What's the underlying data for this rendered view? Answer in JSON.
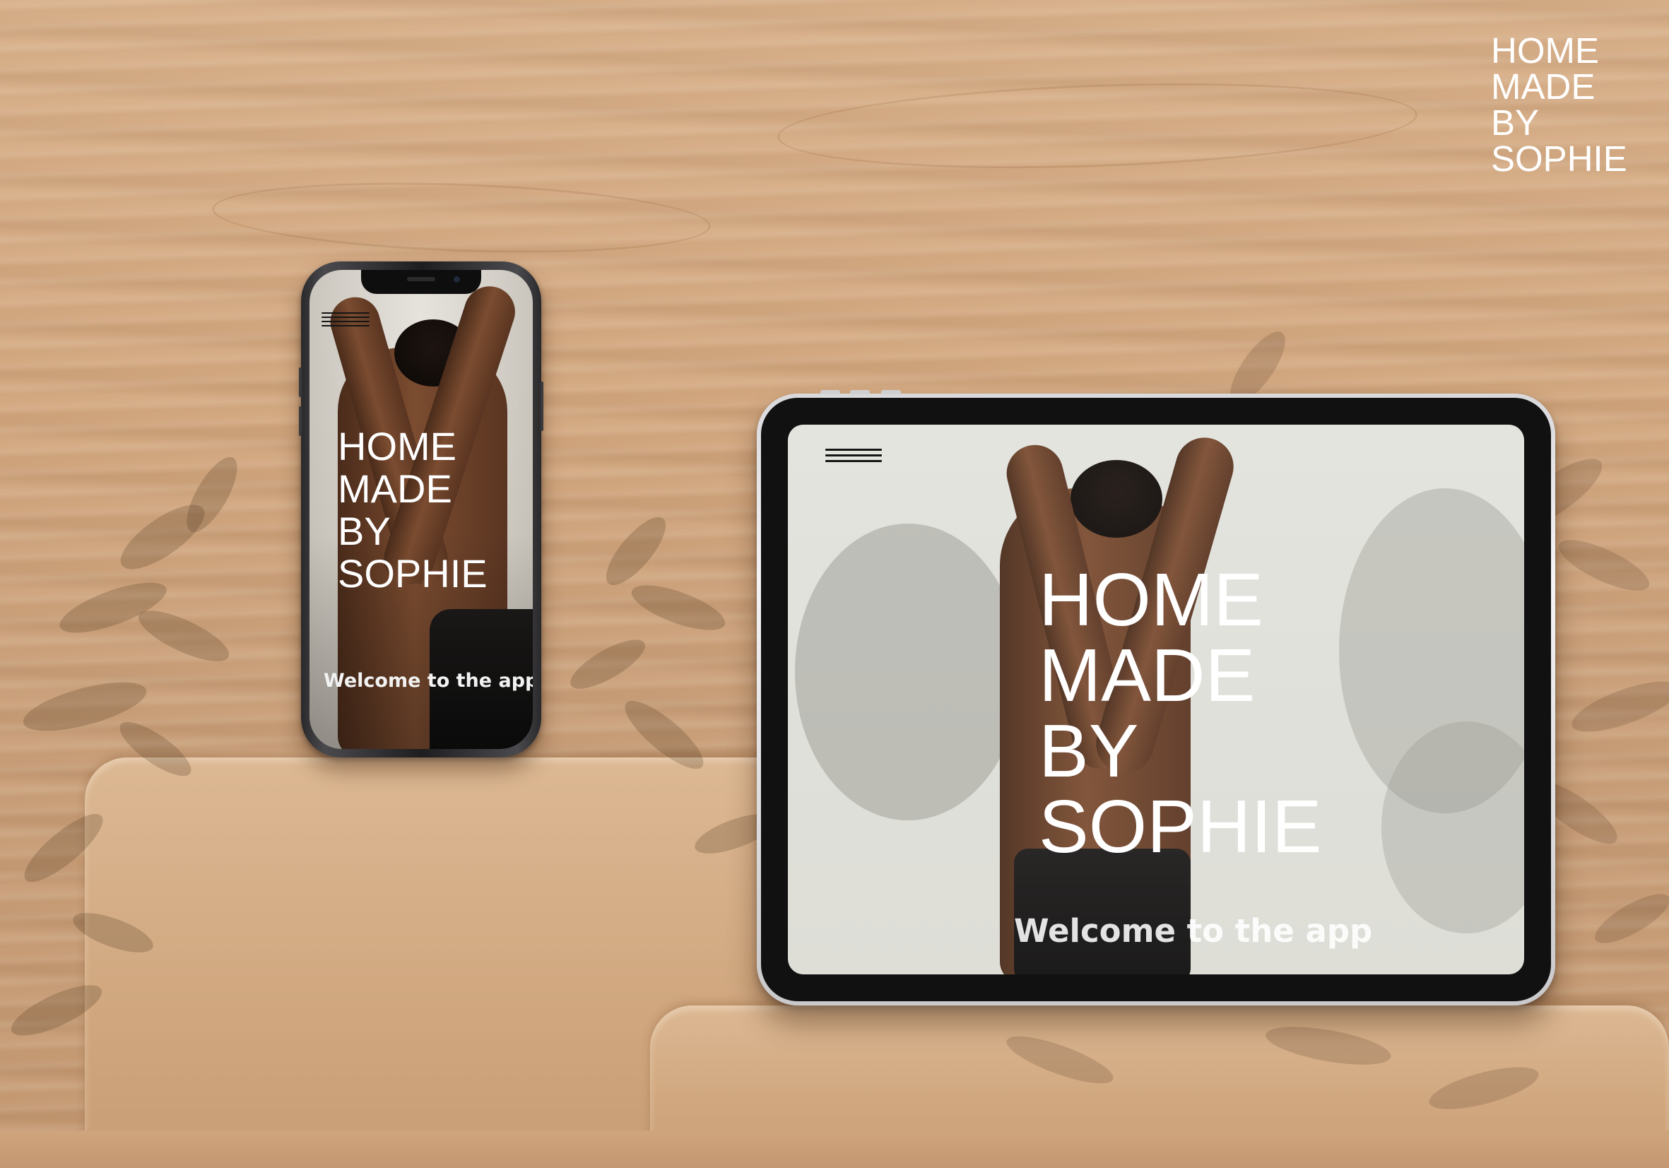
{
  "brand": {
    "logo_lines": [
      "HOME",
      "MADE",
      "BY",
      "SOPHIE"
    ],
    "text_color": "#ffffff"
  },
  "phone": {
    "menu_icon": "hamburger-menu-icon",
    "title_lines": [
      "HOME",
      "MADE",
      "BY",
      "SOPHIE"
    ],
    "welcome_text": "Welcome to the app"
  },
  "tablet": {
    "menu_icon": "hamburger-menu-icon",
    "title_lines": [
      "HOME",
      "MADE",
      "BY",
      "SOPHIE"
    ],
    "welcome_text": "Welcome to the app"
  },
  "colors": {
    "wood": "#d3a880",
    "screen_background": "#e3e3dd",
    "skin": "#6b4029",
    "clothing": "#151313"
  }
}
